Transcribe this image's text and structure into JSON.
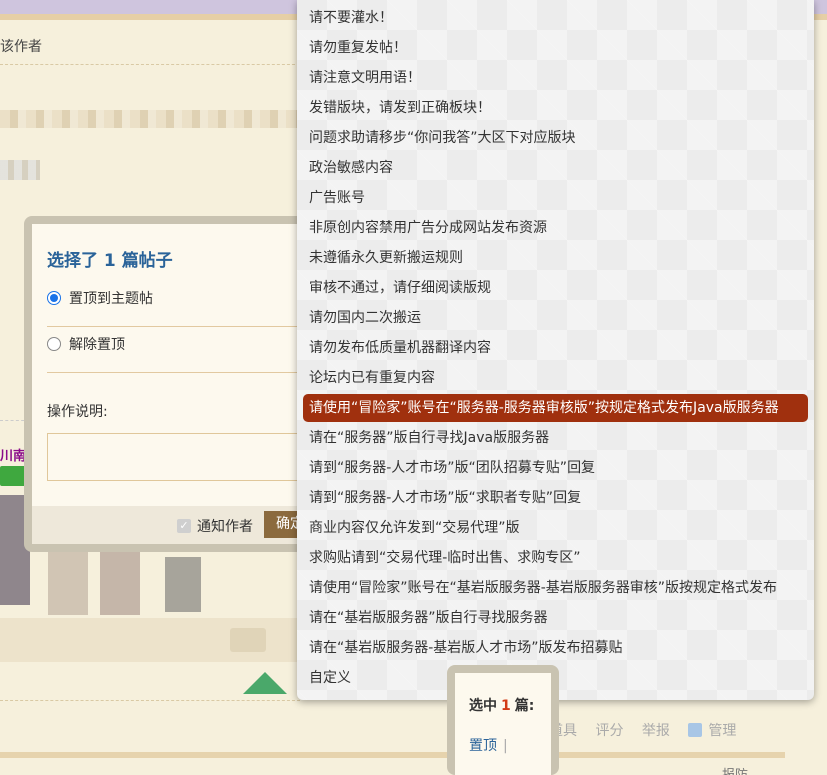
{
  "background": {
    "author_label": "该作者",
    "username_snippet": "川南南",
    "tools": [
      "用道具",
      "评分",
      "举报",
      "管理"
    ],
    "bottom_right_text": "报防"
  },
  "dialog": {
    "title_prefix": "选择了",
    "title_count": "1",
    "title_suffix": "篇帖子",
    "options": [
      {
        "label": "置顶到主题帖",
        "checked": true
      },
      {
        "label": "解除置顶",
        "checked": false
      }
    ],
    "op_label": "操作说明:",
    "notify_label": "通知作者",
    "confirm_label": "确定"
  },
  "reasons": {
    "items": [
      "请不要灌水！",
      "请勿重复发帖！",
      "请注意文明用语！",
      "发错版块，请发到正确板块！",
      "问题求助请移步“你问我答”大区下对应版块",
      "政治敏感内容",
      "广告账号",
      "非原创内容禁用广告分成网站发布资源",
      "未遵循永久更新搬运规则",
      "审核不通过，请仔细阅读版规",
      "请勿国内二次搬运",
      "请勿发布低质量机器翻译内容",
      "论坛内已有重复内容",
      "请使用“冒险家”账号在“服务器-服务器审核版”按规定格式发布Java版服务器",
      "请在“服务器”版自行寻找Java版服务器",
      "请到“服务器-人才市场”版“团队招募专贴”回复",
      "请到“服务器-人才市场”版“求职者专贴”回复",
      "商业内容仅允许发到“交易代理”版",
      "求购贴请到“交易代理-临时出售、求购专区”",
      "请使用“冒险家”账号在“基岩版服务器-基岩版服务器审核”版按规定格式发布",
      "请在“基岩版服务器”版自行寻找服务器",
      "请在“基岩版服务器-基岩版人才市场”版发布招募贴",
      "自定义"
    ],
    "selected_index": 13
  },
  "selection_bar": {
    "prefix": "选中",
    "count": "1",
    "suffix": "篇:",
    "action": "置顶",
    "separator": "|"
  },
  "colors": {
    "accent_blue": "#2a6399",
    "selected_bg": "#a0300e",
    "confirm_bg": "#8b6a3e",
    "count_red": "#d23a17"
  }
}
